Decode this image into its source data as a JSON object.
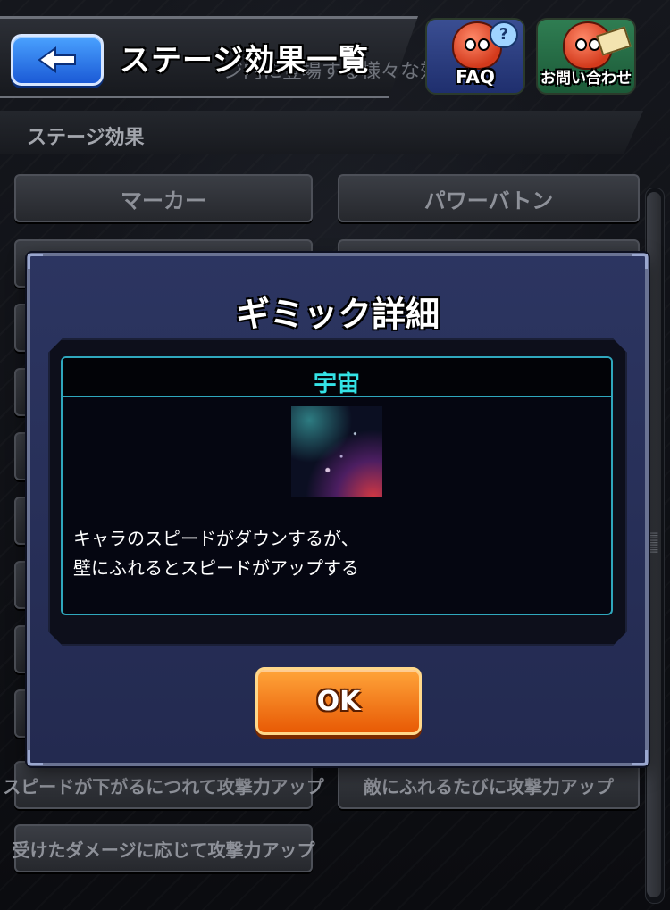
{
  "header": {
    "title": "ステージ効果一覧",
    "subtext": "ジ内に登場する様々な効果をご紹",
    "faq_label": "FAQ",
    "contact_label": "お問い合わせ"
  },
  "section": {
    "title": "ステージ効果"
  },
  "effects": [
    "マーカー",
    "パワーバトン",
    "スピードが下がるにつれて攻撃力アップ",
    "敵にふれるたびに攻撃力アップ",
    "受けたダメージに応じて攻撃力アップ"
  ],
  "modal": {
    "title": "ギミック詳細",
    "gimmick_name": "宇宙",
    "description_line1": "キャラのスピードがダウンするが、",
    "description_line2": "壁にふれるとスピードがアップする",
    "ok_label": "OK"
  },
  "colors": {
    "modal_bg": "#2c3561",
    "gimmick_name": "#34e3e6",
    "ok_button": "#f07a14",
    "back_button": "#2f7df0"
  },
  "icons": [
    "back-arrow-icon",
    "faq-mascot-icon",
    "contact-mascot-icon"
  ]
}
